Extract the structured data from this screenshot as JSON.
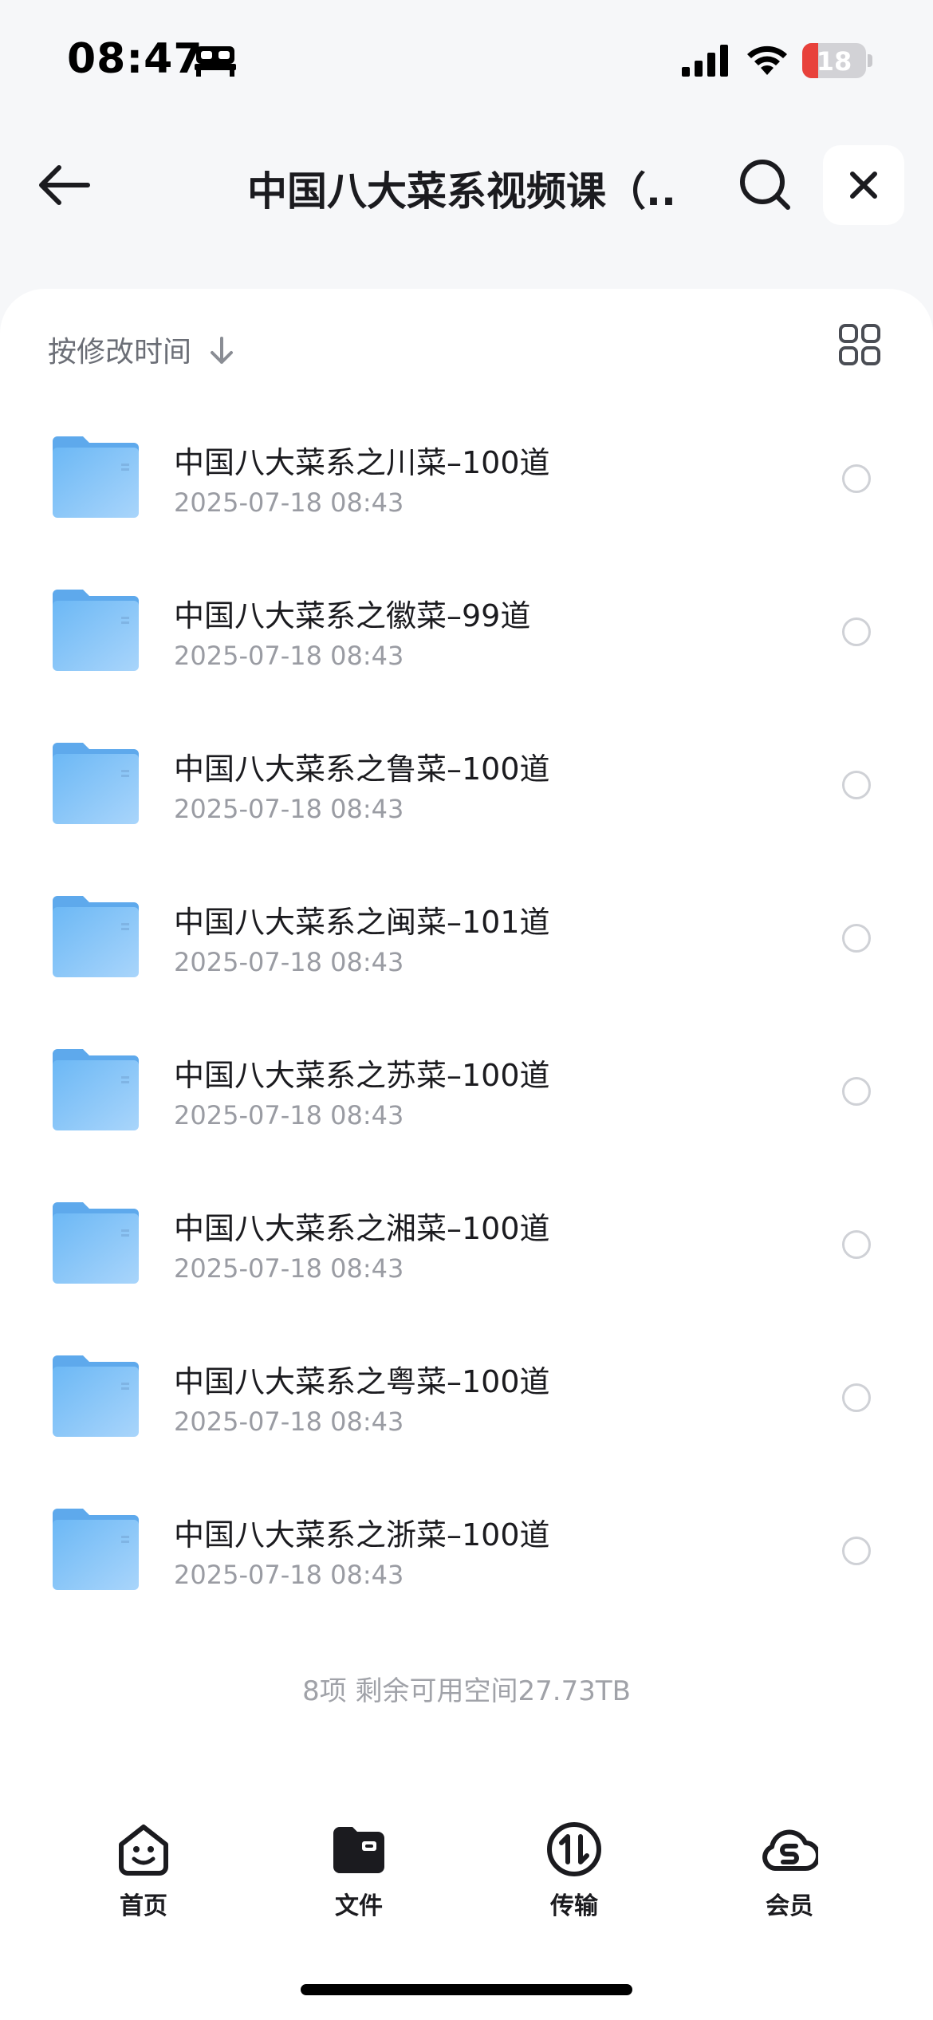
{
  "status_bar": {
    "time": "08:47",
    "battery": "18",
    "icons": [
      "bed-icon",
      "signal-icon",
      "wifi-icon",
      "battery-icon"
    ]
  },
  "header": {
    "title": "中国八大菜系视频课（...",
    "icons": [
      "back-arrow-icon",
      "search-icon",
      "close-icon"
    ]
  },
  "toolbar": {
    "sort_label": "按修改时间",
    "icons": [
      "sort-down-icon",
      "grid-view-icon"
    ]
  },
  "files": [
    {
      "name": "中国八大菜系之川菜–100道",
      "date": "2025-07-18 08:43"
    },
    {
      "name": "中国八大菜系之徽菜–99道",
      "date": "2025-07-18 08:43"
    },
    {
      "name": "中国八大菜系之鲁菜–100道",
      "date": "2025-07-18 08:43"
    },
    {
      "name": "中国八大菜系之闽菜–101道",
      "date": "2025-07-18 08:43"
    },
    {
      "name": "中国八大菜系之苏菜–100道",
      "date": "2025-07-18 08:43"
    },
    {
      "name": "中国八大菜系之湘菜–100道",
      "date": "2025-07-18 08:43"
    },
    {
      "name": "中国八大菜系之粤菜–100道",
      "date": "2025-07-18 08:43"
    },
    {
      "name": "中国八大菜系之浙菜–100道",
      "date": "2025-07-18 08:43"
    }
  ],
  "footer_info": "8项 剩余可用空间27.73TB",
  "tabs": [
    {
      "label": "首页",
      "icon": "home-face-icon"
    },
    {
      "label": "文件",
      "icon": "folder-icon"
    },
    {
      "label": "传输",
      "icon": "transfer-icon"
    },
    {
      "label": "会员",
      "icon": "vip-cloud-icon"
    }
  ],
  "colors": {
    "folder": "#6cb8f5",
    "folder_light": "#a9d5fb",
    "battery_low": "#e8413b",
    "page_bg": "#f6f7f9"
  }
}
